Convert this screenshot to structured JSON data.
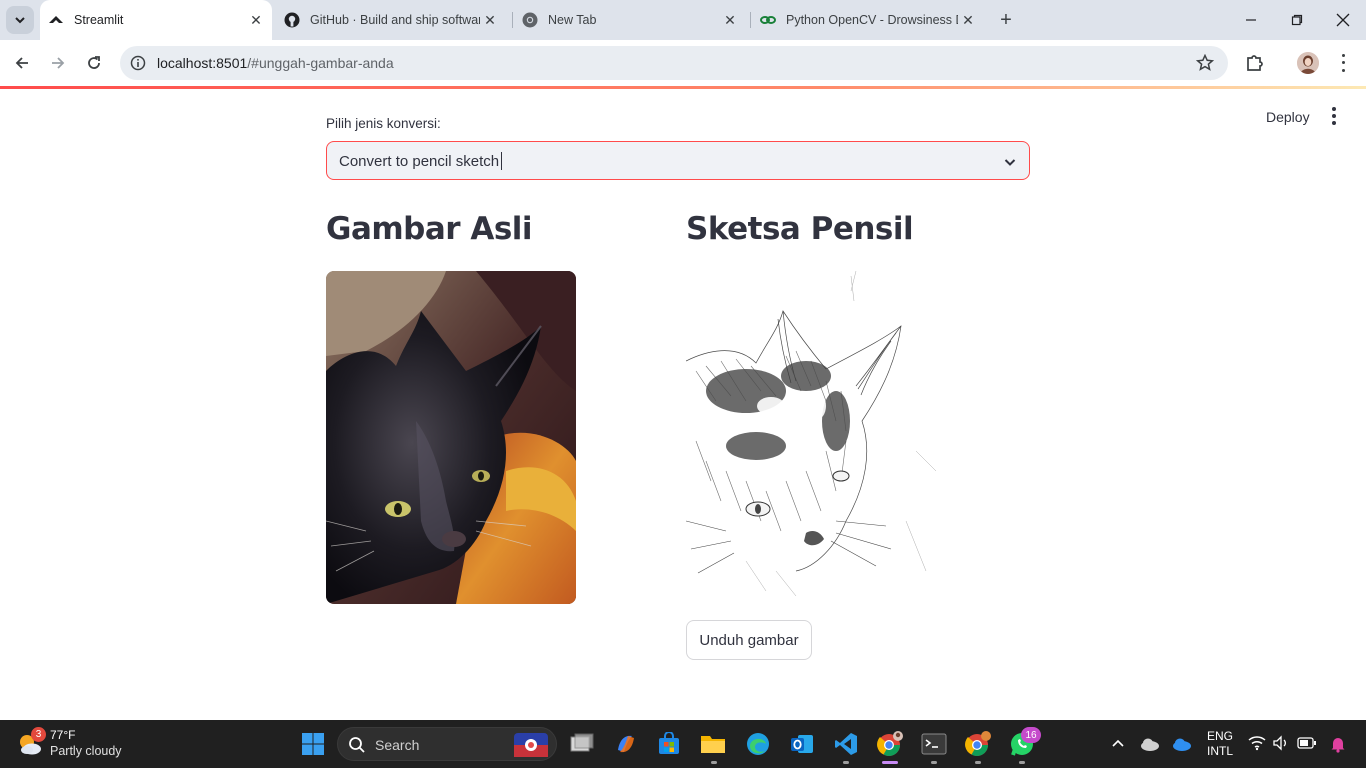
{
  "browser": {
    "tabs": [
      {
        "title": "Streamlit",
        "active": true
      },
      {
        "title": "GitHub · Build and ship software",
        "active": false
      },
      {
        "title": "New Tab",
        "active": false
      },
      {
        "title": "Python OpenCV - Drowsiness D",
        "active": false
      }
    ],
    "url_host": "localhost:8501",
    "url_path": "/#unggah-gambar-anda"
  },
  "app": {
    "deploy_label": "Deploy",
    "select_label": "Pilih jenis konversi:",
    "select_value": "Convert to pencil sketch",
    "left_title": "Gambar Asli",
    "right_title": "Sketsa Pensil",
    "download_label": "Unduh gambar"
  },
  "taskbar": {
    "weather_badge": "3",
    "temperature": "77°F",
    "weather_desc": "Partly cloudy",
    "search_label": "Search",
    "whatsapp_badge": "16",
    "lang_line1": "ENG",
    "lang_line2": "INTL"
  },
  "colors": {
    "accent": "#ff4b4b",
    "taskbar": "#202020",
    "tabstrip": "#dee3eb"
  }
}
